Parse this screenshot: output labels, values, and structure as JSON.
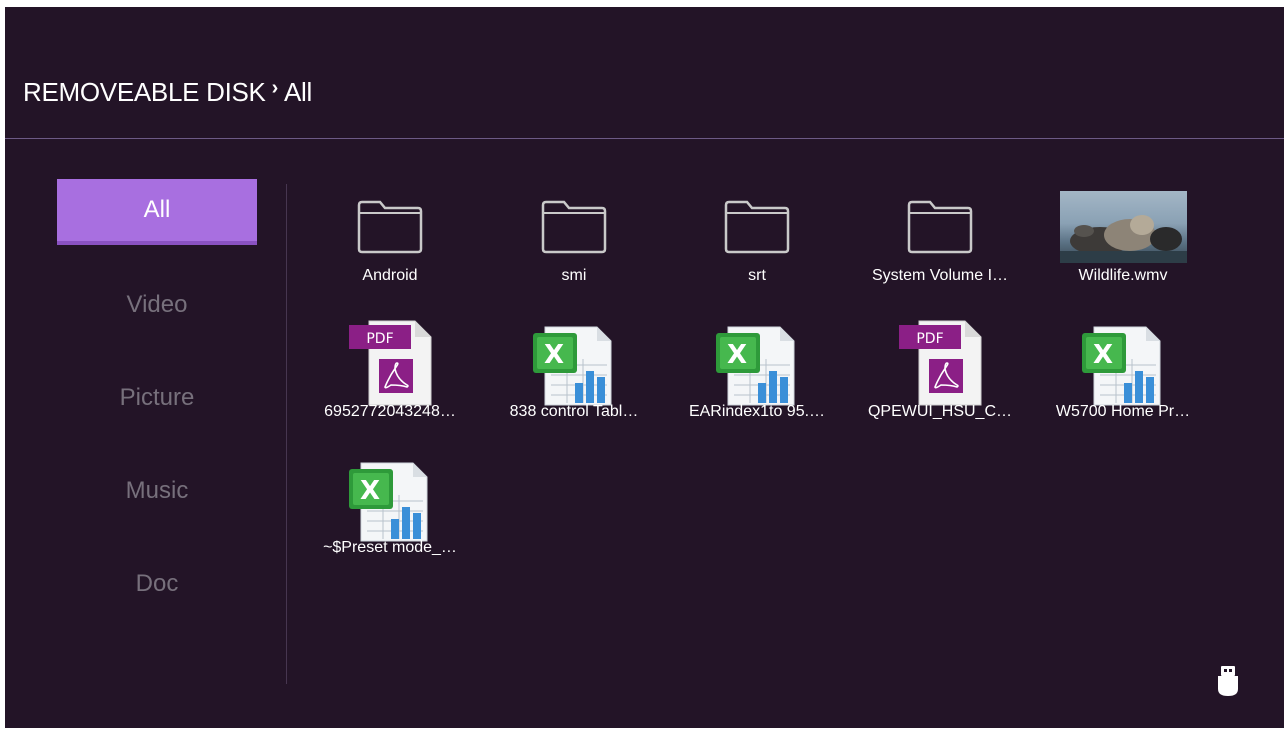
{
  "header": {
    "root": "REMOVEABLE DISK",
    "separator": "›",
    "current": "All"
  },
  "sidebar": {
    "items": [
      {
        "label": "All",
        "active": true
      },
      {
        "label": "Video",
        "active": false
      },
      {
        "label": "Picture",
        "active": false
      },
      {
        "label": "Music",
        "active": false
      },
      {
        "label": "Doc",
        "active": false
      }
    ]
  },
  "files": [
    {
      "name": "Android",
      "type": "folder-icon"
    },
    {
      "name": "smi",
      "type": "folder-icon"
    },
    {
      "name": "srt",
      "type": "folder-icon"
    },
    {
      "name": "System Volume I…",
      "type": "folder-icon"
    },
    {
      "name": "Wildlife.wmv",
      "type": "video-thumbnail"
    },
    {
      "name": "6952772043248…",
      "type": "pdf-icon",
      "badge": "PDF"
    },
    {
      "name": "838 control Tabl…",
      "type": "excel-icon"
    },
    {
      "name": "EARindex1to 95.…",
      "type": "excel-icon"
    },
    {
      "name": "QPEWUI_HSU_C…",
      "type": "pdf-icon",
      "badge": "PDF"
    },
    {
      "name": "W5700 Home Pr…",
      "type": "excel-icon"
    },
    {
      "name": "~$Preset mode_…",
      "type": "excel-icon"
    }
  ],
  "device_icon": "usb-drive-icon",
  "colors": {
    "background": "#231427",
    "accent": "#a86fe0",
    "inactive_text": "#77707c",
    "pdf_purple": "#8b1f86",
    "excel_green": "#2e9a3a"
  }
}
